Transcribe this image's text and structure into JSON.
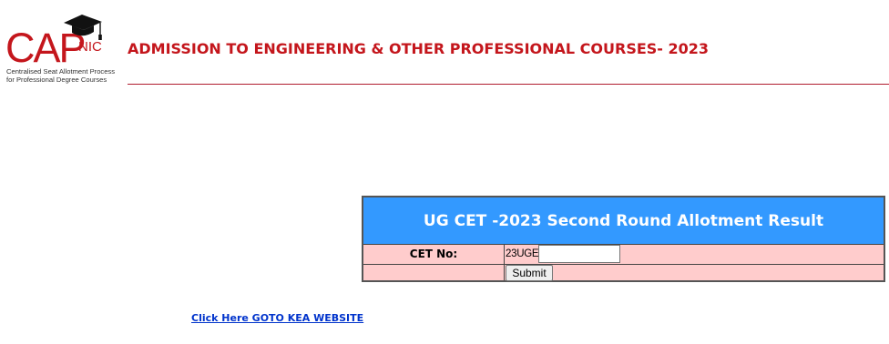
{
  "logo": {
    "letters": "CAP",
    "sub_letters": "NIC",
    "tagline_line1": "Centralised Seat Allotment Process",
    "tagline_line2": "for Professional Degree Courses",
    "cap_icon": "graduation-cap-icon",
    "brand_color": "#c4161c"
  },
  "header": {
    "title": "ADMISSION TO ENGINEERING & OTHER PROFESSIONAL COURSES- 2023",
    "title_color": "#c4161c",
    "rule_color": "#b01c2e"
  },
  "result_form": {
    "title": "UG CET -2023 Second Round Allotment Result",
    "title_bg": "#3399ff",
    "row_bg": "#ffcccc",
    "cet_label": "CET No:",
    "cet_prefix": "23UGE",
    "cet_input_value": "",
    "submit_label": "Submit"
  },
  "footer": {
    "link_text": "Click Here GOTO KEA WEBSITE",
    "link_color": "#0033cc"
  }
}
